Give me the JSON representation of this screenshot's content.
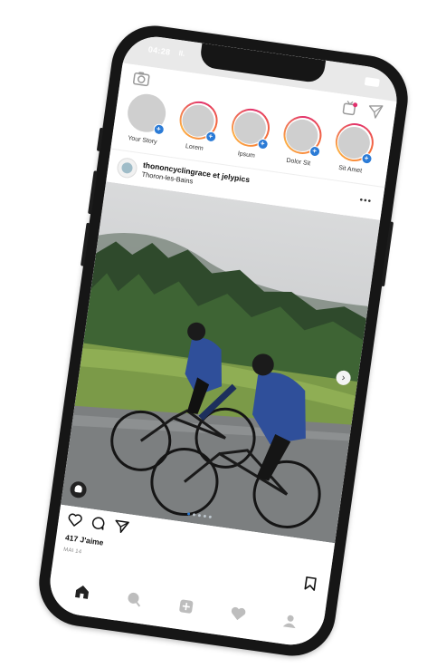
{
  "status_bar": {
    "time": "04:28",
    "signal": "Il."
  },
  "stories": [
    {
      "label": "Your Story",
      "own": true
    },
    {
      "label": "Lorem",
      "own": false
    },
    {
      "label": "Ipsum",
      "own": false
    },
    {
      "label": "Dolor Sit",
      "own": false
    },
    {
      "label": "Sit Amet",
      "own": false
    }
  ],
  "post": {
    "username": "thononcyclingrace et jelypics",
    "location": "Thoron-les-Bains",
    "likes": "417 J'aime",
    "date": "MAI 14",
    "carousel_dots": 5,
    "active_dot": 0,
    "icons": [
      "heart-icon",
      "comment-icon",
      "share-icon",
      "bookmark-icon"
    ]
  },
  "bottom_nav": [
    "home-icon",
    "search-icon",
    "add-post-icon",
    "activity-icon",
    "profile-icon"
  ],
  "colors": {
    "accent_blue": "#2b7bd6",
    "story_ring": "#e1306c",
    "phone_frame": "#161616"
  }
}
